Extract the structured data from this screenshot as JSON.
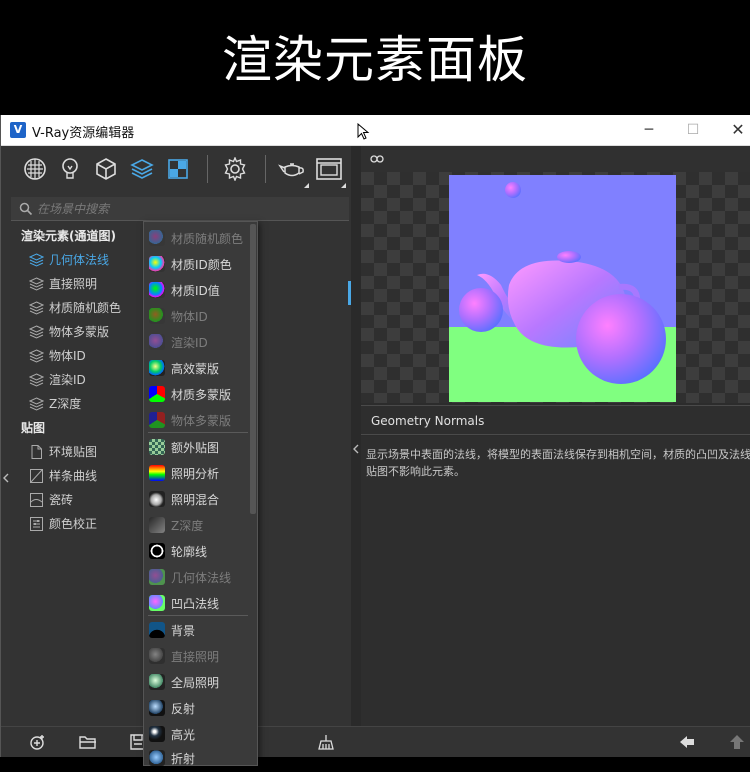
{
  "banner": {
    "title": "渲染元素面板"
  },
  "window": {
    "title": "V-Ray资源编辑器",
    "app_icon_letter": "V"
  },
  "search": {
    "placeholder": "在场景中搜索"
  },
  "tree": {
    "render_elements": {
      "label": "渲染元素(通道图)",
      "items": [
        "几何体法线",
        "直接照明",
        "材质随机颜色",
        "物体多蒙版",
        "物体ID",
        "渲染ID",
        "Z深度"
      ]
    },
    "textures": {
      "label": "贴图",
      "items": [
        "环境贴图",
        "样条曲线",
        "瓷砖",
        "颜色校正"
      ]
    }
  },
  "dropdown": {
    "items": [
      {
        "label": "材质随机颜色",
        "disabled": true
      },
      {
        "label": "材质ID颜色",
        "disabled": false
      },
      {
        "label": "材质ID值",
        "disabled": false
      },
      {
        "label": "物体ID",
        "disabled": true
      },
      {
        "label": "渲染ID",
        "disabled": true
      },
      {
        "label": "高效蒙版",
        "disabled": false
      },
      {
        "label": "材质多蒙版",
        "disabled": false
      },
      {
        "label": "物体多蒙版",
        "disabled": true
      },
      {
        "label": "额外贴图",
        "disabled": false
      },
      {
        "label": "照明分析",
        "disabled": false
      },
      {
        "label": "照明混合",
        "disabled": false
      },
      {
        "label": "Z深度",
        "disabled": true
      },
      {
        "label": "轮廓线",
        "disabled": false
      },
      {
        "label": "几何体法线",
        "disabled": true
      },
      {
        "label": "凹凸法线",
        "disabled": false
      },
      {
        "label": "背景",
        "disabled": false
      },
      {
        "label": "直接照明",
        "disabled": true
      },
      {
        "label": "全局照明",
        "disabled": false
      },
      {
        "label": "反射",
        "disabled": false
      },
      {
        "label": "高光",
        "disabled": false
      },
      {
        "label": "折射",
        "disabled": false
      }
    ]
  },
  "info": {
    "title": "Geometry Normals",
    "description": "显示场景中表面的法线，将模型的表面法线保存到相机空间，材质的凸凹及法线贴图不影响此元素。"
  },
  "colors": {
    "accent": "#4aa8e6",
    "normal_bg_top": "#8080ff",
    "normal_bg_ground": "#80ff80"
  }
}
